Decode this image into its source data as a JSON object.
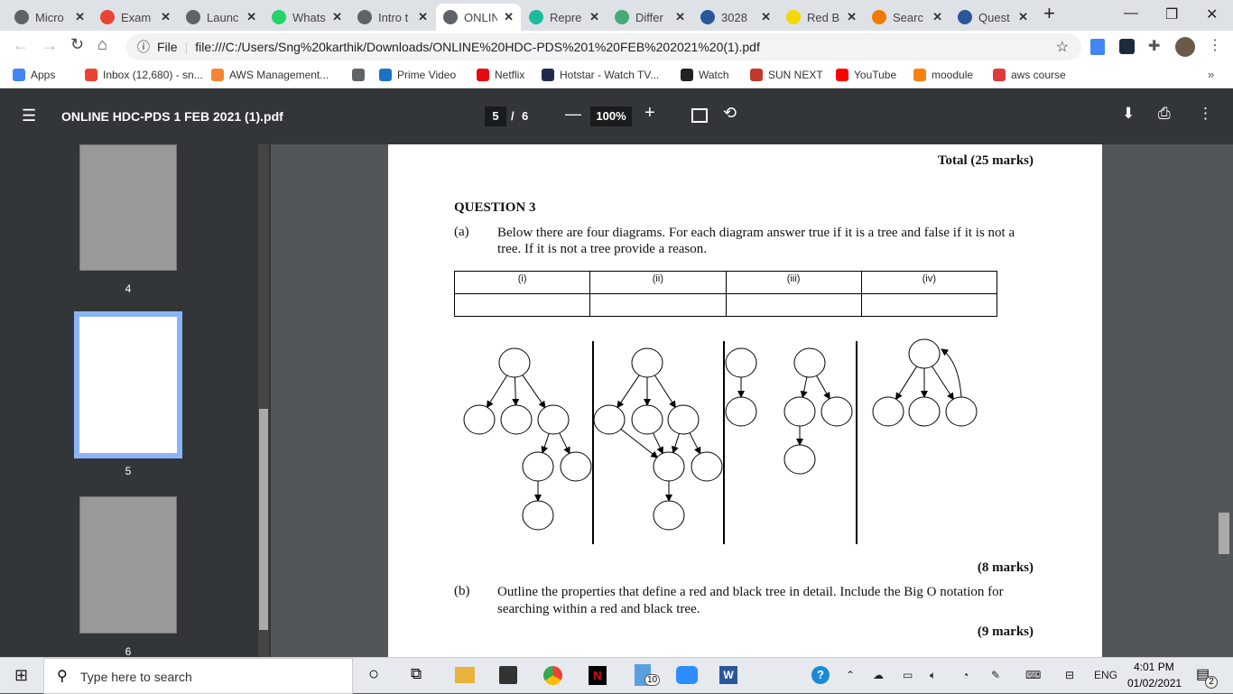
{
  "browser": {
    "tabs": [
      {
        "label": "Micro",
        "icon": "globe",
        "color": "#5f6368"
      },
      {
        "label": "Exam",
        "icon": "gmail",
        "color": "#ea4335"
      },
      {
        "label": "Launc",
        "icon": "globe",
        "color": "#5f6368"
      },
      {
        "label": "Whats",
        "icon": "whatsapp",
        "color": "#25d366"
      },
      {
        "label": "Intro t",
        "icon": "globe",
        "color": "#5f6368"
      },
      {
        "label": "ONLIN",
        "icon": "globe",
        "color": "#5f6368",
        "active": true
      },
      {
        "label": "Repre",
        "icon": "shield",
        "color": "#1abc9c"
      },
      {
        "label": "Differ",
        "icon": "diamond",
        "color": "#4a7"
      },
      {
        "label": "3028",
        "icon": "word",
        "color": "#2b579a"
      },
      {
        "label": "Red B",
        "icon": "yellow",
        "color": "#f5d800"
      },
      {
        "label": "Searc",
        "icon": "c-logo",
        "color": "#f07b00"
      },
      {
        "label": "Quest",
        "icon": "word",
        "color": "#2b579a"
      }
    ],
    "new_tab": "+",
    "url_scheme": "File",
    "url": "file:///C:/Users/Sng%20karthik/Downloads/ONLINE%20HDC-PDS%201%20FEB%202021%20(1).pdf",
    "bookmarks": [
      {
        "label": "Apps",
        "color": "#4285f4"
      },
      {
        "label": "Inbox (12,680) - sn...",
        "color": "#ea4335"
      },
      {
        "label": "AWS Management...",
        "color": "#f58536"
      },
      {
        "label": "",
        "color": "#5f6368"
      },
      {
        "label": "Prime Video",
        "color": "#1a73c8"
      },
      {
        "label": "Netflix",
        "color": "#e50914"
      },
      {
        "label": "Hotstar - Watch TV...",
        "color": "#1f2a4e"
      },
      {
        "label": "Watch",
        "color": "#222"
      },
      {
        "label": "SUN NEXT",
        "color": "#c0392b"
      },
      {
        "label": "YouTube",
        "color": "#ff0000"
      },
      {
        "label": "moodule",
        "color": "#f98012"
      },
      {
        "label": "aws course",
        "color": "#e0393e"
      }
    ],
    "more": "»"
  },
  "pdf": {
    "title": "ONLINE HDC-PDS 1 FEB 2021 (1).pdf",
    "page": "5",
    "sep": "/",
    "total": "6",
    "zoom": "100%",
    "thumbs": [
      "4",
      "5",
      "6"
    ]
  },
  "doc": {
    "total": "Total (25 marks)",
    "q": "QUESTION 3",
    "a_label": "(a)",
    "a_text": "Below there are four diagrams. For each diagram answer true if it is a tree and false if it is not a tree. If it is not a tree provide a reason.",
    "cols": [
      "(i)",
      "(ii)",
      "(iii)",
      "(iv)"
    ],
    "marks_a": "(8 marks)",
    "b_label": "(b)",
    "b_text": "Outline the properties that define a red and black tree in detail. Include the Big O notation for searching within a red and black tree.",
    "marks_b": "(9 marks)"
  },
  "taskbar": {
    "search": "Type here to search",
    "lang": "ENG",
    "time": "4:01 PM",
    "date": "01/02/2021",
    "notif": "2",
    "badge": "10"
  }
}
